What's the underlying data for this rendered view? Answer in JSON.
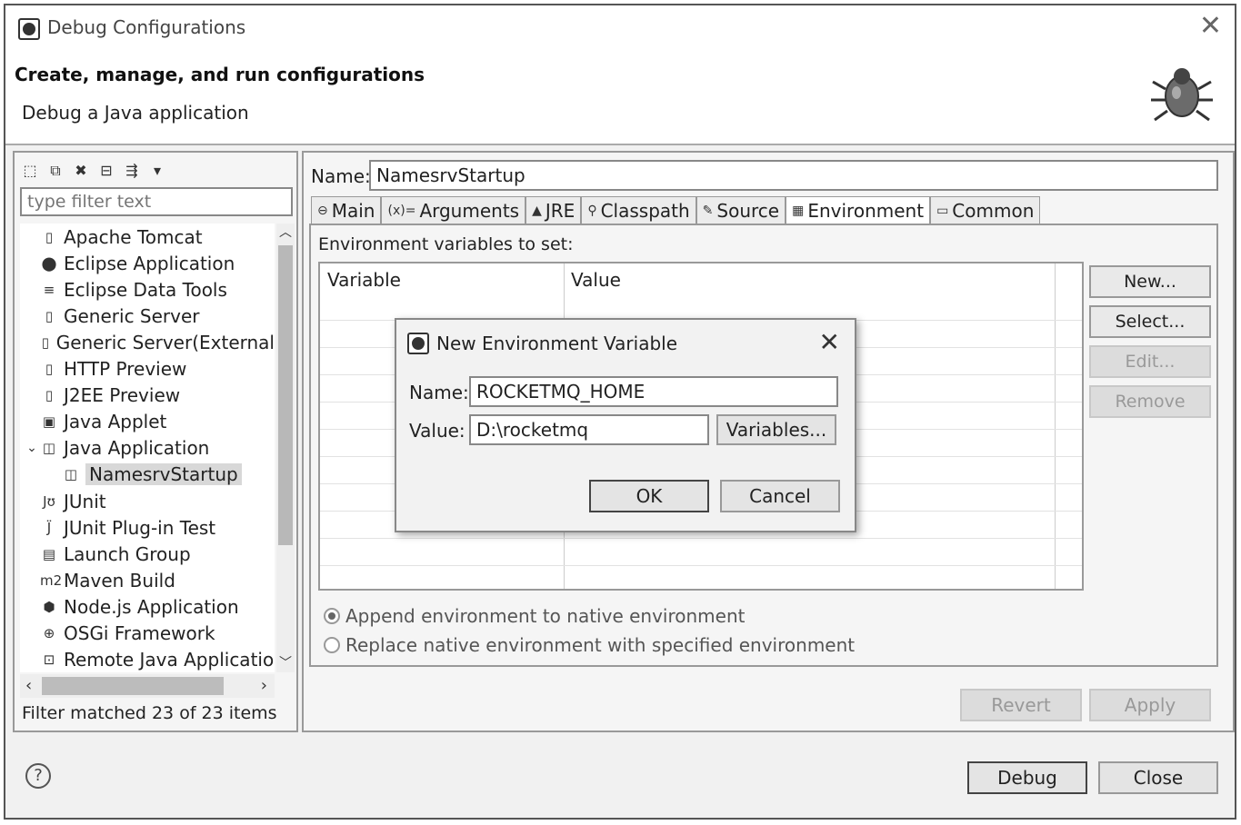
{
  "window": {
    "title": "Debug Configurations"
  },
  "header": {
    "title": "Create, manage, and run configurations",
    "subtitle": "Debug a Java application",
    "icon": "bug-icon"
  },
  "left": {
    "filter_placeholder": "type filter text",
    "tree": [
      {
        "label": "Apache Tomcat",
        "icon": "server-icon",
        "glyph": "▯"
      },
      {
        "label": "Eclipse Application",
        "icon": "eclipse-icon",
        "glyph": "⬤"
      },
      {
        "label": "Eclipse Data Tools",
        "icon": "database-icon",
        "glyph": "≡"
      },
      {
        "label": "Generic Server",
        "icon": "server-icon",
        "glyph": "▯"
      },
      {
        "label": "Generic Server(External",
        "icon": "server-icon",
        "glyph": "▯"
      },
      {
        "label": "HTTP Preview",
        "icon": "server-icon",
        "glyph": "▯"
      },
      {
        "label": "J2EE Preview",
        "icon": "server-icon",
        "glyph": "▯"
      },
      {
        "label": "Java Applet",
        "icon": "applet-icon",
        "glyph": "▣"
      },
      {
        "label": "Java Application",
        "icon": "java-app-icon",
        "glyph": "◫",
        "expanded": true
      },
      {
        "label": "NamesrvStartup",
        "icon": "java-app-icon",
        "glyph": "◫",
        "child": true,
        "selected": true
      },
      {
        "label": "JUnit",
        "icon": "junit-icon",
        "glyph": "Jʊ"
      },
      {
        "label": "JUnit Plug-in Test",
        "icon": "junit-plugin-icon",
        "glyph": "J̈"
      },
      {
        "label": "Launch Group",
        "icon": "launch-group-icon",
        "glyph": "▤"
      },
      {
        "label": "Maven Build",
        "icon": "maven-icon",
        "glyph": "m2"
      },
      {
        "label": "Node.js Application",
        "icon": "nodejs-icon",
        "glyph": "⬢"
      },
      {
        "label": "OSGi Framework",
        "icon": "osgi-icon",
        "glyph": "⊕"
      },
      {
        "label": "Remote Java Applicatio",
        "icon": "remote-java-icon",
        "glyph": "⊡"
      }
    ],
    "status": "Filter matched 23 of 23 items"
  },
  "right": {
    "name_label": "Name:",
    "name_value": "NamesrvStartup",
    "tabs": [
      {
        "label": "Main",
        "icon": "main-tab-icon",
        "glyph": "⊖"
      },
      {
        "label": "Arguments",
        "icon": "arguments-tab-icon",
        "glyph": "(x)="
      },
      {
        "label": "JRE",
        "icon": "jre-tab-icon",
        "glyph": "▲"
      },
      {
        "label": "Classpath",
        "icon": "classpath-tab-icon",
        "glyph": "⚲"
      },
      {
        "label": "Source",
        "icon": "source-tab-icon",
        "glyph": "✎"
      },
      {
        "label": "Environment",
        "icon": "environment-tab-icon",
        "glyph": "▦",
        "active": true
      },
      {
        "label": "Common",
        "icon": "common-tab-icon",
        "glyph": "▭"
      }
    ],
    "env_label": "Environment variables to set:",
    "columns": [
      "Variable",
      "Value"
    ],
    "buttons": {
      "new": "New...",
      "select": "Select...",
      "edit": "Edit...",
      "remove": "Remove"
    },
    "radio_append": "Append environment to native environment",
    "radio_replace": "Replace native environment with specified environment",
    "revert": "Revert",
    "apply": "Apply"
  },
  "footer": {
    "debug": "Debug",
    "close": "Close",
    "help": "?"
  },
  "dialog": {
    "title": "New Environment Variable",
    "name_label": "Name:",
    "name_value": "ROCKETMQ_HOME",
    "value_label": "Value:",
    "value_value": "D:\\rocketmq",
    "variables": "Variables...",
    "ok": "OK",
    "cancel": "Cancel"
  }
}
